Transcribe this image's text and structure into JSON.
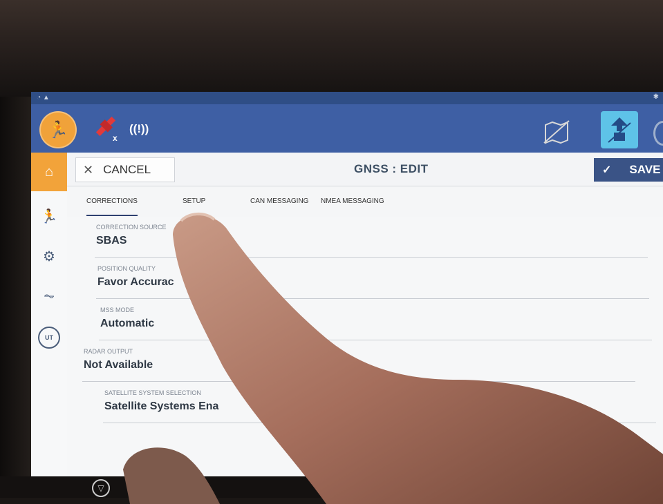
{
  "topbar": {
    "radio_text": "((!))"
  },
  "header": {
    "cancel_label": "CANCEL",
    "title": "GNSS : EDIT",
    "save_label": "SAVE"
  },
  "tabs": [
    {
      "label": "CORRECTIONS",
      "active": true
    },
    {
      "label": "SETUP",
      "active": false
    },
    {
      "label": "CAN MESSAGING",
      "active": false
    },
    {
      "label": "NMEA MESSAGING",
      "active": false
    }
  ],
  "fields": [
    {
      "label": "CORRECTION SOURCE",
      "value": "SBAS"
    },
    {
      "label": "POSITION QUALITY",
      "value": "Favor Accurac"
    },
    {
      "label": "MSS MODE",
      "value": "Automatic"
    },
    {
      "label": "RADAR OUTPUT",
      "value": "Not Available"
    },
    {
      "label": "SATELLITE SYSTEM SELECTION",
      "value": "Satellite Systems Ena"
    }
  ],
  "sidebar": {
    "ut_label": "UT"
  },
  "colors": {
    "topbar": "#3e5fa4",
    "accent_orange": "#f2a33a",
    "save_button": "#3a5386"
  }
}
